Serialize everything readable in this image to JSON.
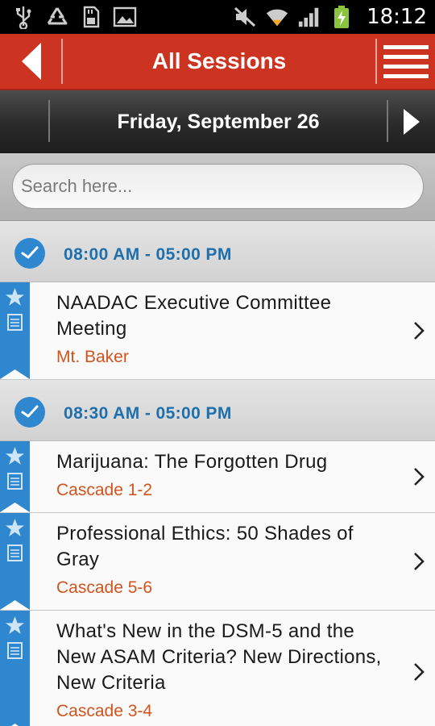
{
  "status_bar": {
    "time": "18:12",
    "icons": [
      "usb-icon",
      "recycle-icon",
      "sd-card-icon",
      "image-icon",
      "mute-icon",
      "wifi-icon",
      "signal-icon",
      "battery-charging-icon"
    ]
  },
  "header": {
    "title": "All Sessions",
    "back_icon": "back-arrow-icon",
    "menu_icon": "hamburger-menu-icon"
  },
  "date_nav": {
    "date": "Friday, September 26",
    "next_icon": "next-arrow-icon"
  },
  "search": {
    "placeholder": "Search here..."
  },
  "groups": [
    {
      "time": "08:00 AM - 05:00 PM",
      "sessions": [
        {
          "title": "NAADAC Executive Committee Meeting",
          "room": "Mt. Baker"
        }
      ]
    },
    {
      "time": "08:30 AM - 05:00 PM",
      "sessions": [
        {
          "title": "Marijuana: The Forgotten Drug",
          "room": "Cascade 1-2"
        },
        {
          "title": "Professional Ethics: 50 Shades of Gray",
          "room": "Cascade 5-6"
        },
        {
          "title": "What's New in the DSM-5 and the New ASAM Criteria? New Directions, New Criteria",
          "room": "Cascade 3-4"
        }
      ]
    }
  ],
  "colors": {
    "header_red": "#cc3320",
    "time_blue": "#1f6fad",
    "ribbon_blue": "#2f88cf",
    "room_orange": "#d2531c"
  }
}
